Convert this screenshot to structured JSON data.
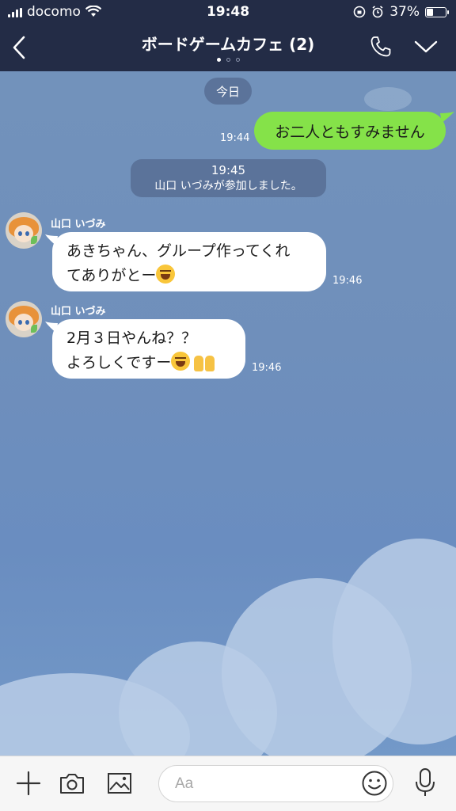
{
  "status_bar": {
    "carrier": "docomo",
    "time": "19:48",
    "battery": "37%",
    "battery_level": 0.37
  },
  "header": {
    "title": "ボードゲームカフェ (2)",
    "page_dots": 3,
    "active_dot": 0
  },
  "chat": {
    "date_label": "今日",
    "messages": [
      {
        "sender": "self",
        "text": "お二人ともすみません",
        "time": "19:44"
      },
      {
        "type": "system",
        "time": "19:45",
        "text": "山口 いづみが参加しました。"
      },
      {
        "sender": "山口 いづみ",
        "line1": "あきちゃん、グループ作ってくれ",
        "line2": "てありがとー",
        "emoji": "grinning-squint-emoji",
        "time": "19:46"
      },
      {
        "sender": "山口 いづみ",
        "line1": "2月３日やんね？？",
        "line2": "よろしくですー",
        "emoji": [
          "grinning-squint-emoji",
          "raising-hands-emoji"
        ],
        "time": "19:46"
      }
    ]
  },
  "input": {
    "placeholder": "Aa"
  },
  "icons": {
    "back": "chevron-left-icon",
    "call": "phone-icon",
    "menu": "chevron-down-icon",
    "add": "plus-icon",
    "camera": "camera-icon",
    "image": "image-icon",
    "emoji": "smiley-icon",
    "voice": "microphone-icon"
  },
  "colors": {
    "header_bg": "#232c46",
    "chat_bg": "#7292bb",
    "self_bubble": "#85e249",
    "other_bubble": "#ffffff",
    "system_pill": "#5b739a"
  }
}
